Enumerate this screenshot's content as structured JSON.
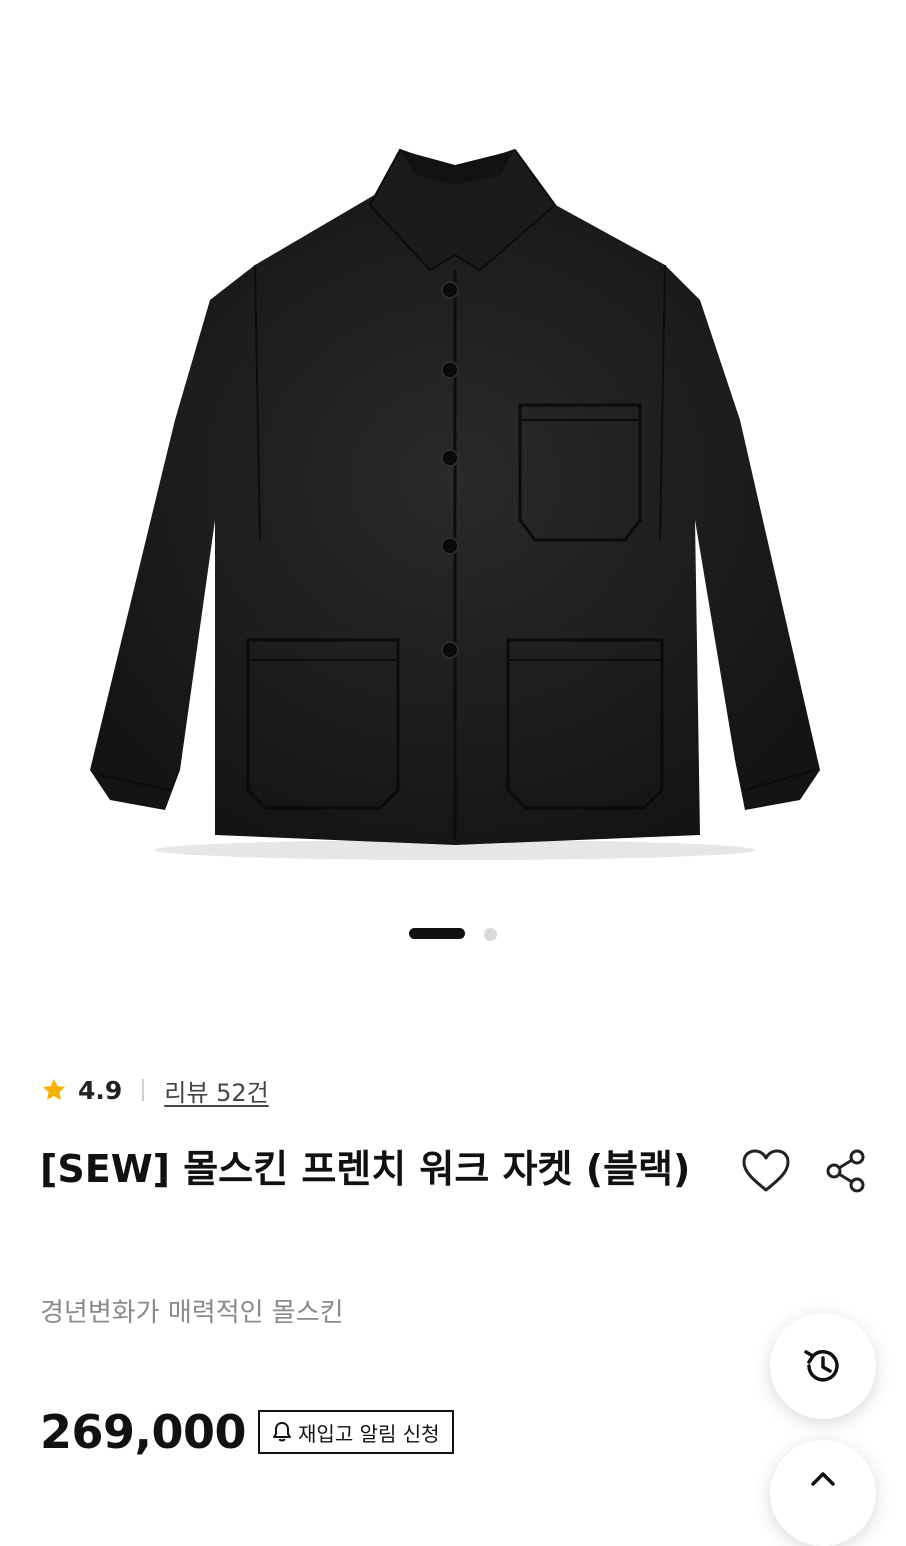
{
  "product": {
    "image_icon": "black-work-jacket-photo",
    "rating": "4.9",
    "reviews_link": "리뷰 52건",
    "title": "[SEW] 몰스킨 프렌치 워크 자켓 (블랙)",
    "subtitle": "경년변화가 매력적인 몰스킨",
    "price": "269,000",
    "restock_label": "재입고 알림 신청"
  },
  "carousel": {
    "total_slides": 2,
    "active_index": 0
  },
  "icons": {
    "rating": "star-icon",
    "like": "heart-icon",
    "share": "share-icon",
    "restock": "bell-icon",
    "recent": "history-icon",
    "top": "chevron-up-icon"
  },
  "colors": {
    "star": "#f5b301",
    "text": "#111111",
    "muted": "#8a8a8a"
  }
}
